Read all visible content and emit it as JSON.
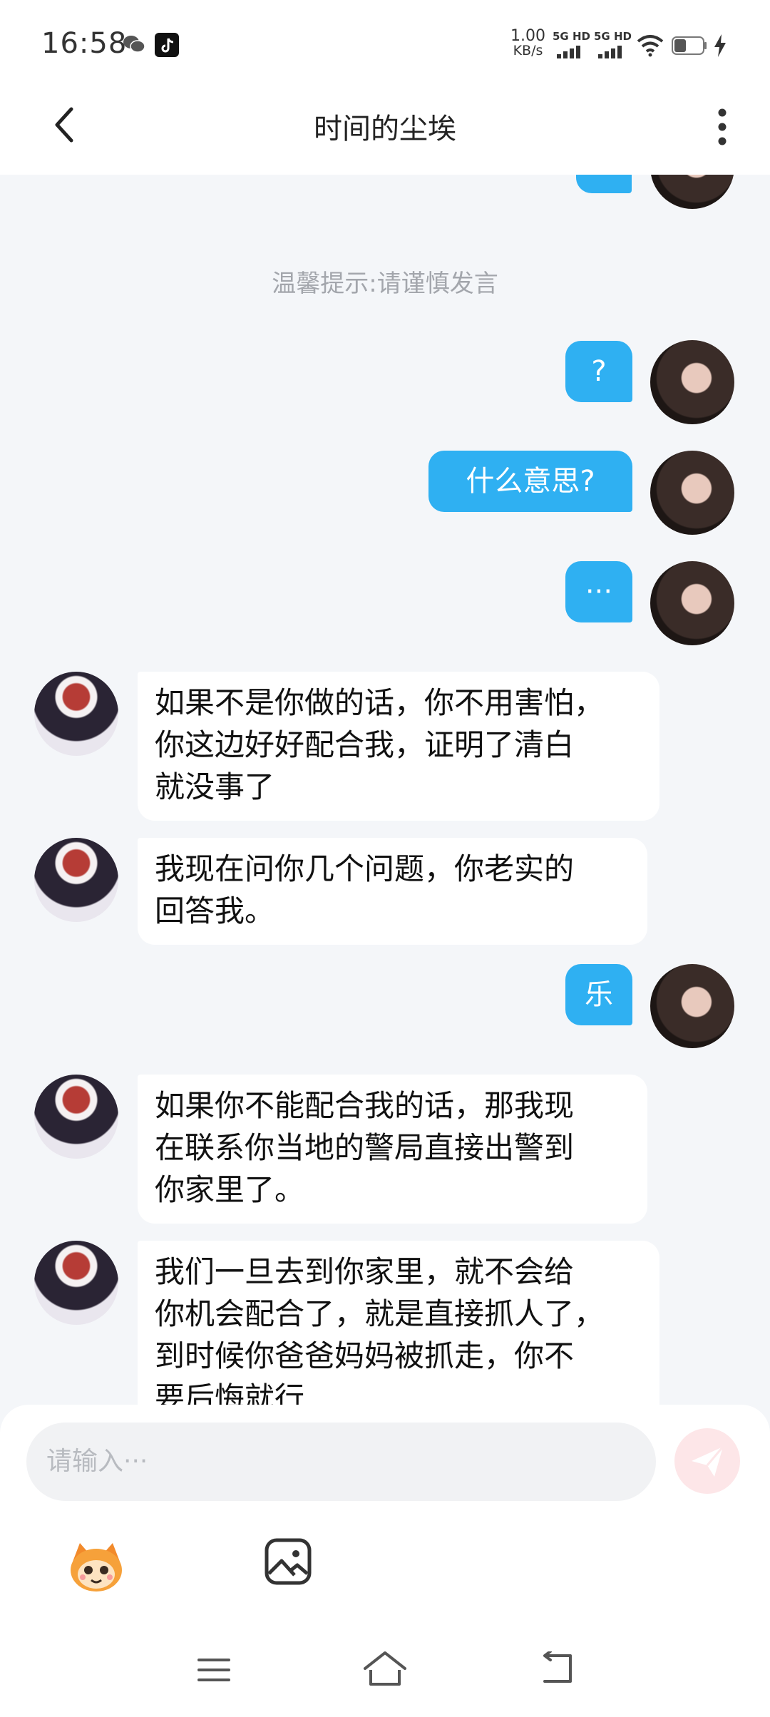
{
  "status_bar": {
    "time": "16:58",
    "net_speed_value": "1.00",
    "net_speed_unit": "KB/s",
    "sim1_label": "5G HD",
    "sim2_label": "5G HD"
  },
  "header": {
    "title": "时间的尘埃"
  },
  "chat": {
    "tip": "温馨提示:请谨慎发言",
    "messages": [
      {
        "from": "self",
        "text": "?"
      },
      {
        "from": "self",
        "text": "什么意思?"
      },
      {
        "from": "self",
        "text": "···"
      },
      {
        "from": "other",
        "lines": [
          "如果不是你做的话，你不用害怕，",
          "你这边好好配合我，证明了清白",
          "就没事了"
        ]
      },
      {
        "from": "other",
        "lines": [
          "我现在问你几个问题，你老实的",
          "回答我。"
        ]
      },
      {
        "from": "self",
        "text": "乐"
      },
      {
        "from": "other",
        "lines": [
          "如果你不能配合我的话，那我现",
          "在联系你当地的警局直接出警到",
          "你家里了。"
        ]
      },
      {
        "from": "other",
        "lines": [
          "我们一旦去到你家里，就不会给",
          "你机会配合了，就是直接抓人了，",
          "到时候你爸爸妈妈被抓走，你不",
          "要后悔就行"
        ]
      }
    ]
  },
  "composer": {
    "placeholder": "请输入···"
  },
  "icons": {
    "back": "chevron-left-icon",
    "more": "more-vertical-icon",
    "send": "paper-plane-icon",
    "emoji": "emoji-face-icon",
    "image": "image-icon"
  },
  "colors": {
    "accent": "#2fb0f2",
    "background": "#f4f6f9",
    "send_disabled": "#fde6e8"
  }
}
